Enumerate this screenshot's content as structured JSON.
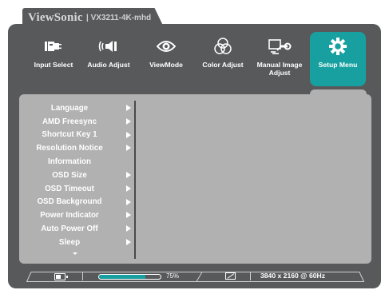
{
  "header": {
    "brand": "ViewSonic",
    "model": "| VX3211-4K-mhd"
  },
  "tabs": [
    {
      "label": "Input Select",
      "icon": "input-select-icon",
      "active": false
    },
    {
      "label": "Audio Adjust",
      "icon": "speaker-icon",
      "active": false
    },
    {
      "label": "ViewMode",
      "icon": "eye-icon",
      "active": false
    },
    {
      "label": "Color Adjust",
      "icon": "color-circles-icon",
      "active": false
    },
    {
      "label": "Manual Image Adjust",
      "icon": "image-adjust-icon",
      "active": false
    },
    {
      "label": "Setup Menu",
      "icon": "gear-icon",
      "active": true
    }
  ],
  "menu": {
    "items": [
      {
        "label": "Language",
        "has_submenu": true
      },
      {
        "label": "AMD Freesync",
        "has_submenu": true
      },
      {
        "label": "Shortcut Key 1",
        "has_submenu": true
      },
      {
        "label": "Resolution Notice",
        "has_submenu": true
      },
      {
        "label": "Information",
        "has_submenu": false
      },
      {
        "label": "OSD Size",
        "has_submenu": true
      },
      {
        "label": "OSD Timeout",
        "has_submenu": true
      },
      {
        "label": "OSD Background",
        "has_submenu": true
      },
      {
        "label": "Power Indicator",
        "has_submenu": true
      },
      {
        "label": "Auto Power Off",
        "has_submenu": true
      },
      {
        "label": "Sleep",
        "has_submenu": true
      }
    ],
    "more_icon": "chevron-down-icon"
  },
  "status": {
    "brightness_percent": 75,
    "brightness_label": "75%",
    "resolution": "3840 x 2160 @ 60Hz",
    "battery_level": 0.7
  },
  "colors": {
    "accent": "#18a0a0",
    "frame": "#58595b",
    "panel": "#b1b1b1"
  }
}
